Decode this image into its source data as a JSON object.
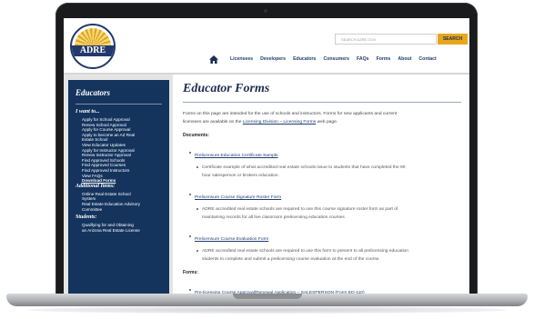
{
  "header": {
    "search_placeholder": "SEARCH AZRE.GOV",
    "search_button": "SEARCH",
    "logo_text": "ADRE",
    "nav": [
      "Licensees",
      "Developers",
      "Educators",
      "Consumers",
      "FAQs",
      "Forms",
      "About",
      "Contact"
    ]
  },
  "sidebar": {
    "title": "Educators",
    "sections": [
      {
        "heading": "I want to...",
        "items": [
          "Apply for School Approval",
          "Renew School Approval",
          "Apply for Course Approval",
          "Apply to become an AZ Real",
          "Estate School",
          "View Educator Updates",
          "Apply for Instructor Approval",
          "Renew Instructor Approval",
          "Find Approved Schools",
          "Find Approved Courses",
          "Find Approved Instructors",
          "View FAQs",
          "Download Forms"
        ]
      },
      {
        "heading": "Additional Items:",
        "items": [
          "Online Real Estate School",
          "System",
          "Real Estate Education Advisory",
          "Committee"
        ]
      },
      {
        "heading": "Students:",
        "items": [
          "Qualifying for and Obtaining",
          "an Arizona Real Estate License"
        ]
      }
    ]
  },
  "main": {
    "title": "Educator Forms",
    "intro_1": "Forms on this page are intended for the use of schools and instructors. Forms for new applicants and current",
    "intro_2a": "licensees are available on the ",
    "intro_link": "Licensing Division – Licensing Forms",
    "intro_2b": " web page.",
    "documents_label": "Documents:",
    "documents": [
      {
        "link": "Prelicensure Education Certificate Sample",
        "desc_1": "Certificate example of what accredited real estate schools issue to students that have completed the 90",
        "desc_2": "hour salesperson or brokers education."
      },
      {
        "link": "Prelicensure Course Signature Roster Form",
        "desc_1": "ADRE accredited real estate schools are required to use this course signature roster form as part of",
        "desc_2": "maintaining records for all live classroom prelicensing education courses"
      },
      {
        "link": "Prelicensure Course Evaluation Form",
        "desc_1": "ADRE accredited real estate schools are required to use this form to present to all prelicensing education",
        "desc_2": "students to complete and submit a prelicensing course evaluation at the end of the course."
      }
    ],
    "forms_label": "Forms:",
    "forms": [
      "Pre-licensing Course Approval/Renewal Application – SALESPERSON (Form ED-110)"
    ]
  }
}
